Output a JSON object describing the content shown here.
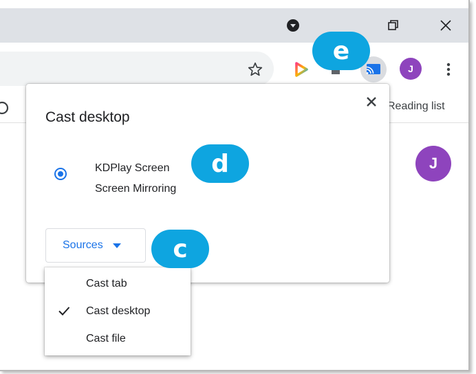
{
  "window": {
    "minimize_icon": "incognito-dot-icon",
    "restore_icon": "restore-icon",
    "close_icon": "close-icon"
  },
  "toolbar": {
    "star_icon": "bookmark-star-icon",
    "extension_icon": "kdplay-extension-icon",
    "cast_icon": "cast-icon",
    "avatar_letter": "J",
    "menu_icon": "kebab-menu-icon"
  },
  "bookmarks": {
    "reading_list": "Reading list"
  },
  "cast_dialog": {
    "title": "Cast desktop",
    "sink_line1": "KDPlay Screen",
    "sink_line2": "Screen Mirroring",
    "sources_label": "Sources"
  },
  "sources_menu": {
    "items": [
      "Cast tab",
      "Cast desktop",
      "Cast file"
    ],
    "selected": "Cast desktop"
  },
  "page": {
    "avatar_letter": "J"
  },
  "callouts": {
    "c": "c",
    "d": "d",
    "e": "e"
  },
  "colors": {
    "accent": "#1a73e8",
    "callout": "#0ea5e0",
    "avatar": "#8e44bd"
  }
}
